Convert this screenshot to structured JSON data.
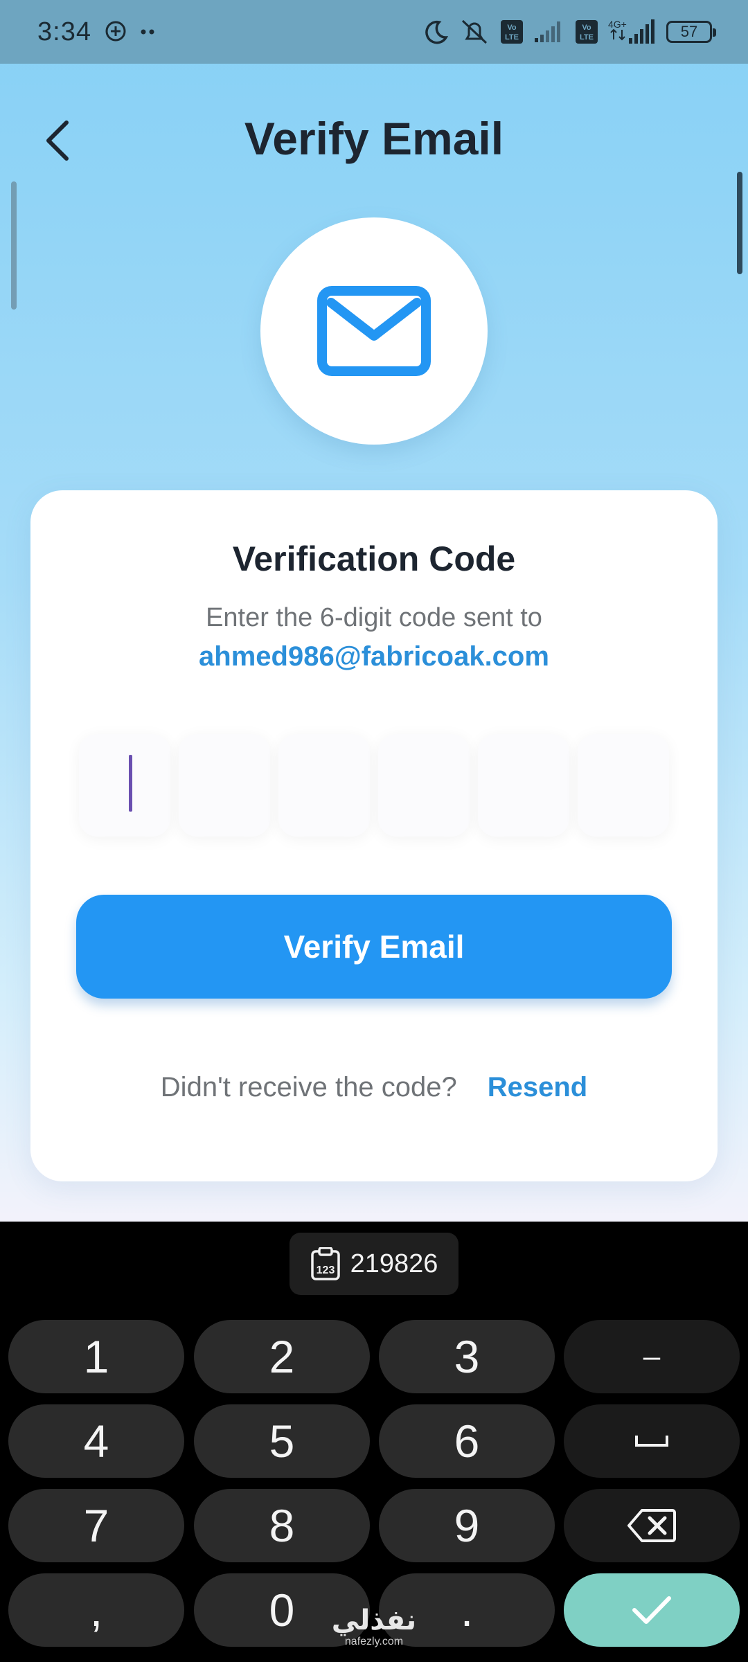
{
  "status_bar": {
    "time": "3:34",
    "battery": "57",
    "network": "4G+",
    "volte_label": "Vo LTE"
  },
  "header": {
    "title": "Verify Email"
  },
  "card": {
    "title": "Verification Code",
    "subtitle": "Enter the 6-digit code sent to",
    "email": "ahmed986@fabricoak.com",
    "otp_digits": [
      "",
      "",
      "",
      "",
      "",
      ""
    ],
    "verify_button": "Verify Email",
    "resend_question": "Didn't receive the code?",
    "resend_link": "Resend"
  },
  "keyboard": {
    "clipboard_suggestion": "219826",
    "keys": [
      [
        "1",
        "2",
        "3",
        "–"
      ],
      [
        "4",
        "5",
        "6",
        "␣"
      ],
      [
        "7",
        "8",
        "9",
        "⌫"
      ],
      [
        ",",
        "0",
        ".",
        "✓"
      ]
    ]
  },
  "watermark": {
    "arabic": "نفذلي",
    "domain": "nafezly.com"
  },
  "colors": {
    "accent": "#2396f3",
    "link": "#2b8fd9",
    "enter_key": "#7fd0c4"
  }
}
